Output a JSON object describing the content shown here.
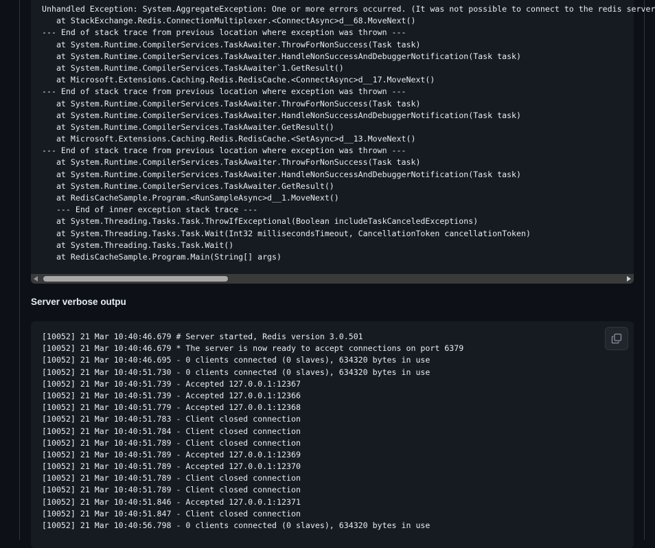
{
  "exception_trace": {
    "lines": [
      "Unhandled Exception: System.AggregateException: One or more errors occurred. (It was not possible to connect to the redis server(s);",
      "   at StackExchange.Redis.ConnectionMultiplexer.<ConnectAsync>d__68.MoveNext()",
      "--- End of stack trace from previous location where exception was thrown ---",
      "   at System.Runtime.CompilerServices.TaskAwaiter.ThrowForNonSuccess(Task task)",
      "   at System.Runtime.CompilerServices.TaskAwaiter.HandleNonSuccessAndDebuggerNotification(Task task)",
      "   at System.Runtime.CompilerServices.TaskAwaiter`1.GetResult()",
      "   at Microsoft.Extensions.Caching.Redis.RedisCache.<ConnectAsync>d__17.MoveNext()",
      "--- End of stack trace from previous location where exception was thrown ---",
      "   at System.Runtime.CompilerServices.TaskAwaiter.ThrowForNonSuccess(Task task)",
      "   at System.Runtime.CompilerServices.TaskAwaiter.HandleNonSuccessAndDebuggerNotification(Task task)",
      "   at System.Runtime.CompilerServices.TaskAwaiter.GetResult()",
      "   at Microsoft.Extensions.Caching.Redis.RedisCache.<SetAsync>d__13.MoveNext()",
      "--- End of stack trace from previous location where exception was thrown ---",
      "   at System.Runtime.CompilerServices.TaskAwaiter.ThrowForNonSuccess(Task task)",
      "   at System.Runtime.CompilerServices.TaskAwaiter.HandleNonSuccessAndDebuggerNotification(Task task)",
      "   at System.Runtime.CompilerServices.TaskAwaiter.GetResult()",
      "   at RedisCacheSample.Program.<RunSampleAsync>d__1.MoveNext()",
      "   --- End of inner exception stack trace ---",
      "   at System.Threading.Tasks.Task.ThrowIfExceptional(Boolean includeTaskCanceledExceptions)",
      "   at System.Threading.Tasks.Task.Wait(Int32 millisecondsTimeout, CancellationToken cancellationToken)",
      "   at System.Threading.Tasks.Task.Wait()",
      "   at RedisCacheSample.Program.Main(String[] args)"
    ]
  },
  "server_section": {
    "heading": "Server verbose outpu",
    "copy_icon": "copy-icon",
    "lines": [
      "[10052] 21 Mar 10:40:46.679 # Server started, Redis version 3.0.501",
      "[10052] 21 Mar 10:40:46.679 * The server is now ready to accept connections on port 6379",
      "[10052] 21 Mar 10:40:46.695 - 0 clients connected (0 slaves), 634320 bytes in use",
      "[10052] 21 Mar 10:40:51.730 - 0 clients connected (0 slaves), 634320 bytes in use",
      "[10052] 21 Mar 10:40:51.739 - Accepted 127.0.0.1:12367",
      "[10052] 21 Mar 10:40:51.739 - Accepted 127.0.0.1:12366",
      "[10052] 21 Mar 10:40:51.779 - Accepted 127.0.0.1:12368",
      "[10052] 21 Mar 10:40:51.783 - Client closed connection",
      "[10052] 21 Mar 10:40:51.784 - Client closed connection",
      "[10052] 21 Mar 10:40:51.789 - Client closed connection",
      "[10052] 21 Mar 10:40:51.789 - Accepted 127.0.0.1:12369",
      "[10052] 21 Mar 10:40:51.789 - Accepted 127.0.0.1:12370",
      "[10052] 21 Mar 10:40:51.789 - Client closed connection",
      "[10052] 21 Mar 10:40:51.789 - Client closed connection",
      "[10052] 21 Mar 10:40:51.846 - Accepted 127.0.0.1:12371",
      "[10052] 21 Mar 10:40:51.847 - Client closed connection",
      "[10052] 21 Mar 10:40:56.798 - 0 clients connected (0 slaves), 634320 bytes in use"
    ]
  },
  "colors": {
    "background": "#0d1117",
    "code_background": "#161b22",
    "text": "#e6edf3",
    "scrollbar_track": "#3a3a3a",
    "scrollbar_thumb": "#a8a8a8"
  },
  "icons": {
    "scroll_left": "triangle-left-icon",
    "scroll_right": "triangle-right-icon"
  }
}
